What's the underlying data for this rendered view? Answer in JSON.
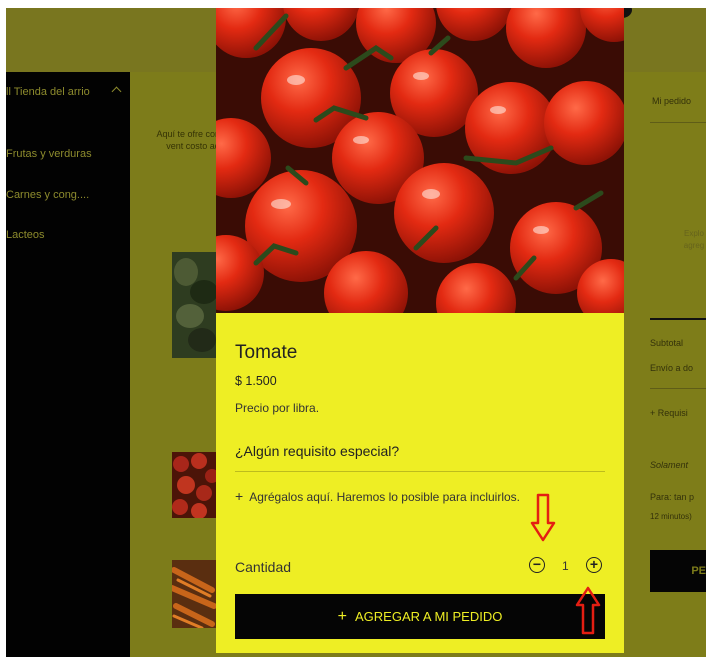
{
  "sidebar": {
    "store_name": "ll Tienda del arrio",
    "items": [
      {
        "label": "Frutas y verduras"
      },
      {
        "label": "Carnes y cong...."
      },
      {
        "label": "Lacteos"
      }
    ]
  },
  "middle": {
    "intro": "Aquí te ofre con la vent costo ad"
  },
  "order_panel": {
    "title": "Mi pedido",
    "empty_hint": "Explo agreg",
    "subtotal": "Subtotal",
    "shipping": "Envío a do",
    "requisitos": "+ Requisi",
    "solamente": "Solament",
    "para": "Para: tan p",
    "minutos": "12 minutos)",
    "button": "PE"
  },
  "product": {
    "name": "Tomate",
    "price": "$ 1.500",
    "unit_note": "Precio por libra.",
    "special_question": "¿Algún requisito especial?",
    "add_requirements": "Agrégalos aquí. Haremos lo posible para incluirlos.",
    "quantity_label": "Cantidad",
    "quantity": "1",
    "add_button": "AGREGAR A MI PEDIDO"
  },
  "colors": {
    "modal_bg": "#eeee24",
    "overlay": "#7d7c1a",
    "button_bg": "#050505",
    "annotation_arrow": "#e41e12"
  },
  "icons": {
    "minus": "minus-circle-icon",
    "plus": "plus-circle-icon",
    "add": "plus-icon",
    "chevron": "chevron-up-icon"
  }
}
